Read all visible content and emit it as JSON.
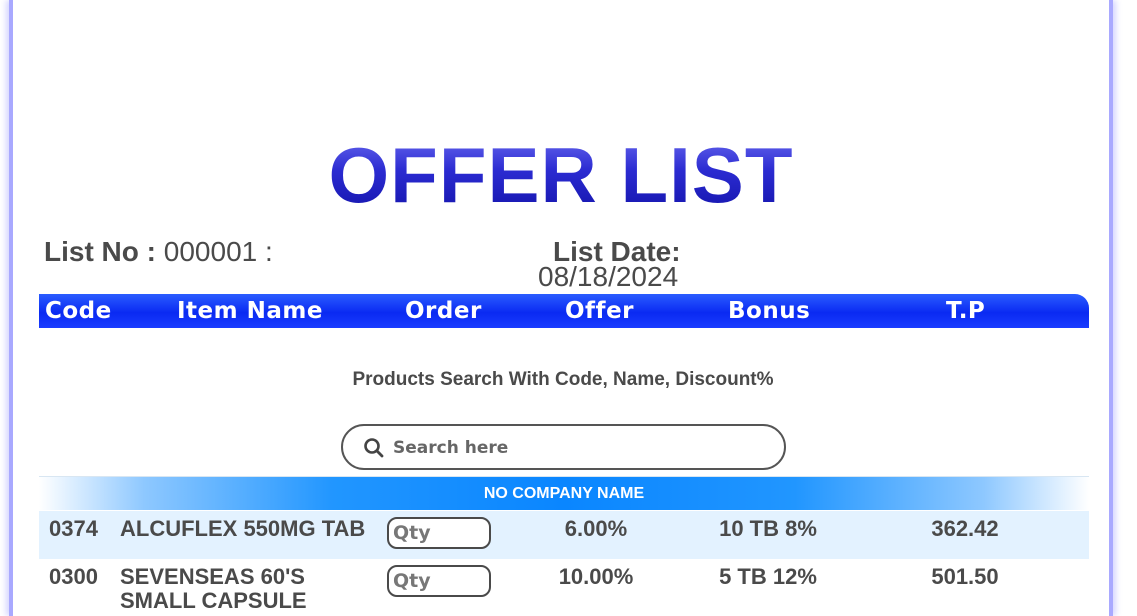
{
  "title": "OFFER LIST",
  "list_info": {
    "list_no_label": "List No :",
    "list_no_value": "000001 :",
    "list_date_label": "List Date:",
    "list_date_value": "08/18/2024"
  },
  "table_header": [
    "Code",
    "Item Name",
    "Order",
    "Offer",
    "Bonus",
    "T.P"
  ],
  "search": {
    "caption": "Products Search With Code, Name, Discount%",
    "placeholder": "Search here"
  },
  "company": "NO COMPANY NAME",
  "qty_placeholder": "Qty",
  "rows": [
    {
      "code": "0374",
      "name": "ALCUFLEX 550MG TAB",
      "offer": "6.00%",
      "bonus": "10 TB 8%",
      "tp": "362.42"
    },
    {
      "code": "0300",
      "name": "SEVENSEAS 60'S SMALL CAPSULE",
      "offer": "10.00%",
      "bonus": "5 TB 12%",
      "tp": "501.50"
    }
  ],
  "colors": {
    "header_bar": "#0a2af2",
    "company_bar": "#0a86ff",
    "row_alt": "#e3f2ff",
    "frame_border": "#a9a9ff"
  },
  "icons": {
    "search": "search-icon"
  }
}
